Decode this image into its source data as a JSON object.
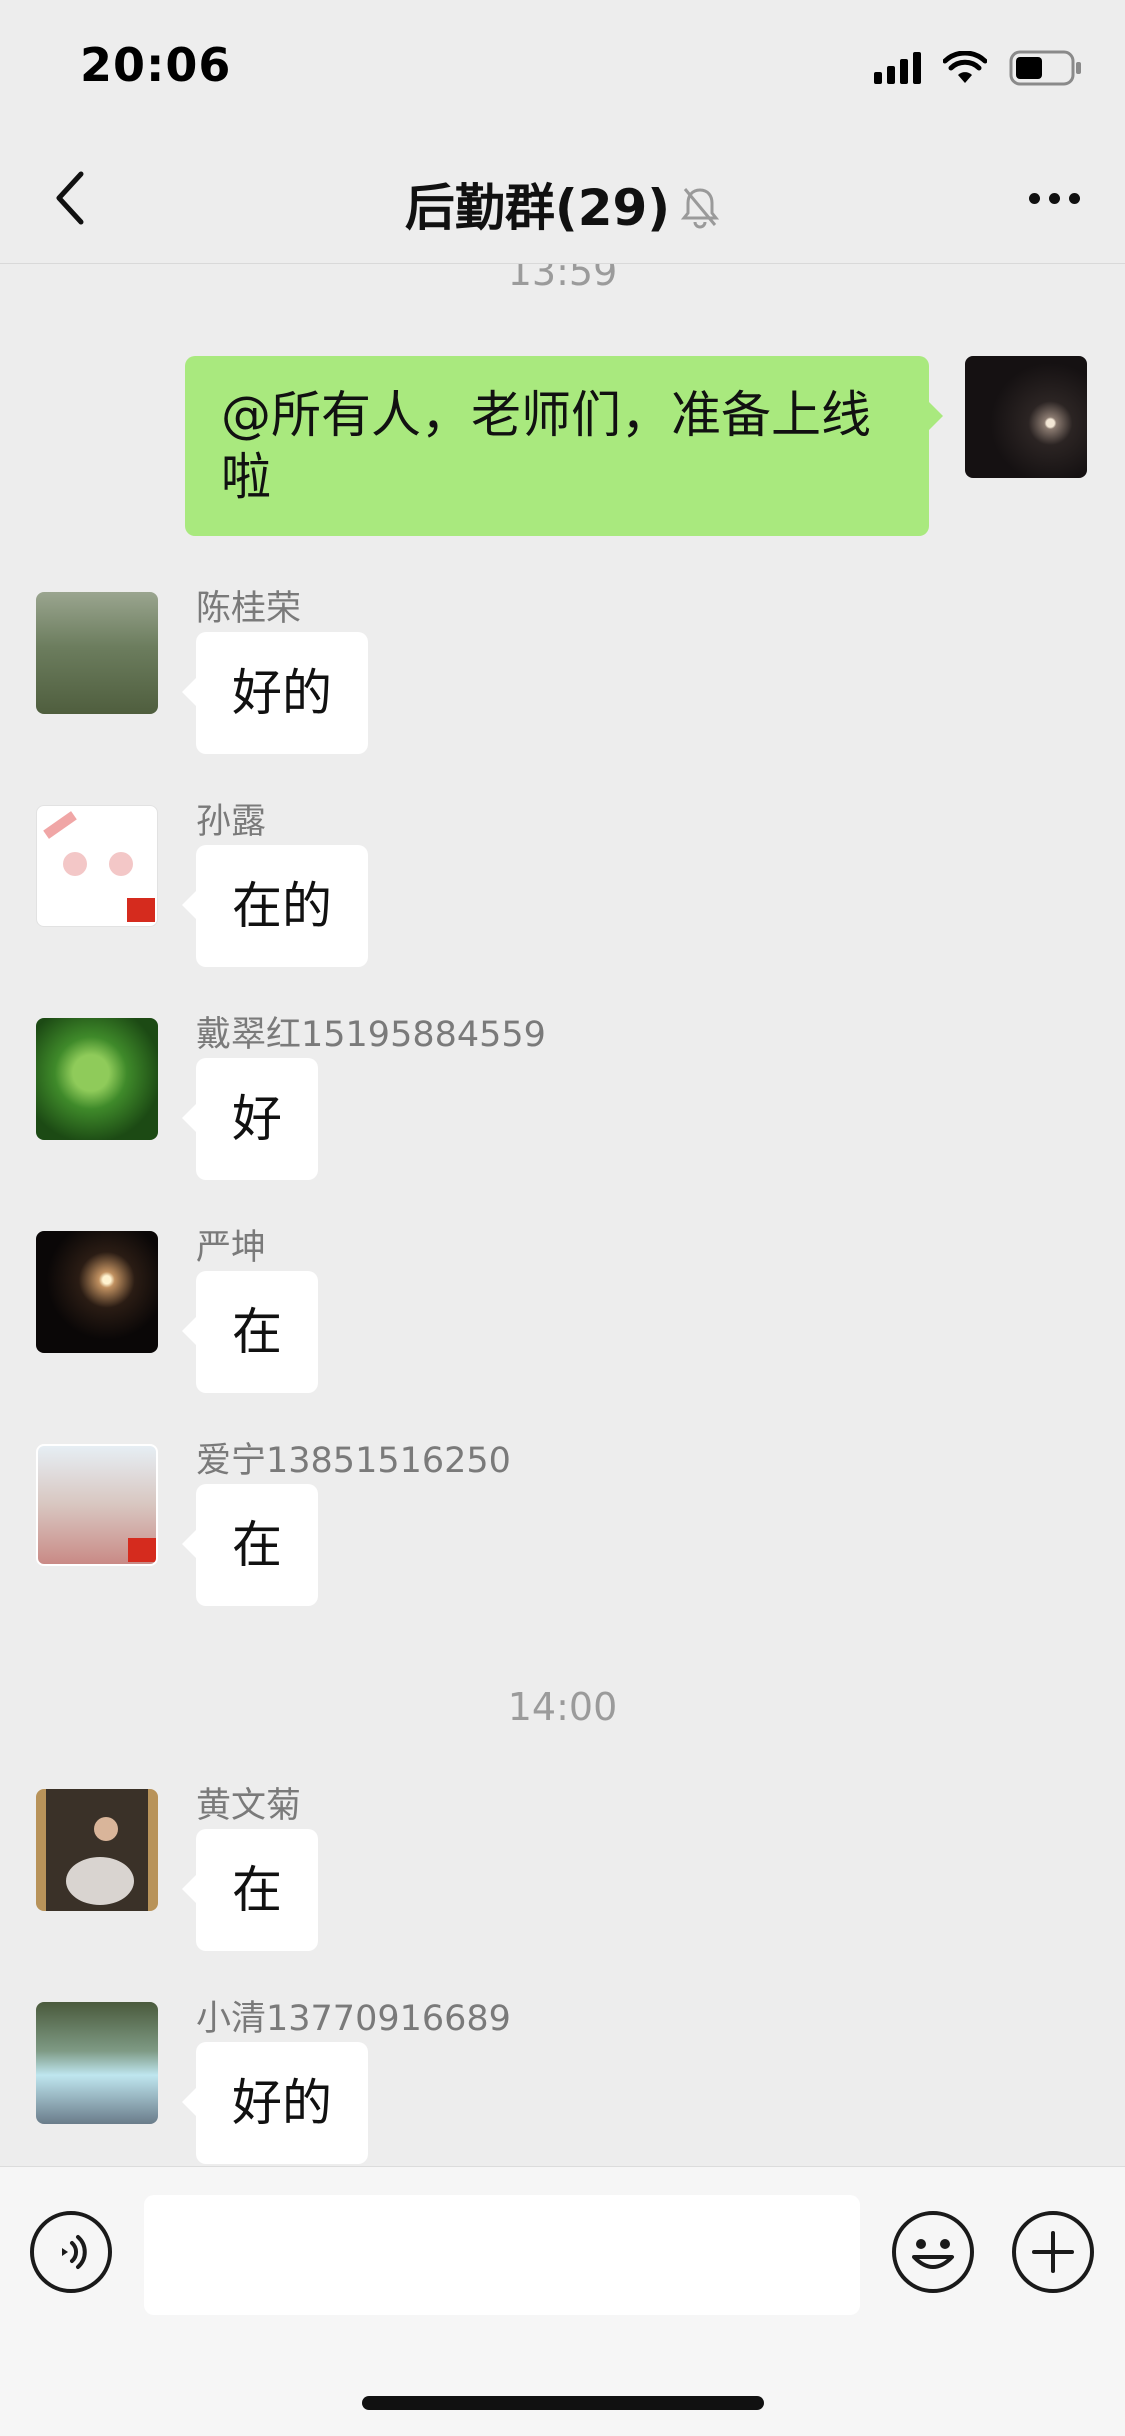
{
  "status_bar": {
    "time": "20:06",
    "battery_percent": 50
  },
  "header": {
    "title": "后勤群(29)",
    "muted": true,
    "icons": {
      "back": "back-chevron-icon",
      "muted": "bell-muted-icon",
      "more": "more-dots-icon"
    }
  },
  "timestamps": [
    "13:59",
    "14:00"
  ],
  "outgoing": {
    "text": "@所有人，老师们，准备上线啦"
  },
  "messages": [
    {
      "sender": "陈桂荣",
      "text": "好的"
    },
    {
      "sender": "孙露",
      "text": "在的"
    },
    {
      "sender": "戴翠红15195884559",
      "text": "好"
    },
    {
      "sender": "严坤",
      "text": "在"
    },
    {
      "sender": "爱宁13851516250",
      "text": "在"
    },
    {
      "sender": "黄文菊",
      "text": "在"
    },
    {
      "sender": "小清13770916689",
      "text": "好的"
    }
  ],
  "input_bar": {
    "placeholder": "",
    "icons": {
      "voice": "voice-icon",
      "emoji": "emoji-icon",
      "plus": "plus-icon"
    }
  },
  "colors": {
    "background": "#ededed",
    "outgoing_bubble": "#a9e97e",
    "incoming_bubble": "#ffffff"
  }
}
